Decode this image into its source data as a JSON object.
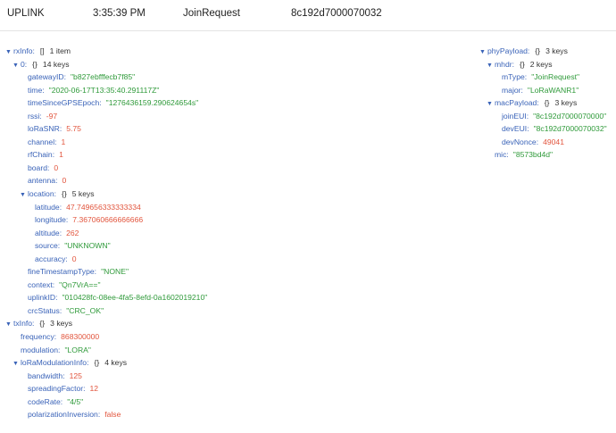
{
  "header": {
    "direction": "UPLINK",
    "time": "3:35:39 PM",
    "type": "JoinRequest",
    "dev_eui": "8c192d7000070032"
  },
  "tree_left": [
    {
      "depth": 0,
      "expandable": true,
      "key": "rxInfo",
      "brace": "[]",
      "meta": "1 item"
    },
    {
      "depth": 1,
      "expandable": true,
      "key": "0",
      "brace": "{}",
      "meta": "14 keys"
    },
    {
      "depth": 2,
      "key": "gatewayID",
      "value": "\"b827ebfffecb7f85\"",
      "vtype": "str"
    },
    {
      "depth": 2,
      "key": "time",
      "value": "\"2020-06-17T13:35:40.291117Z\"",
      "vtype": "str"
    },
    {
      "depth": 2,
      "key": "timeSinceGPSEpoch",
      "value": "\"1276436159.290624654s\"",
      "vtype": "str"
    },
    {
      "depth": 2,
      "key": "rssi",
      "value": "-97",
      "vtype": "num"
    },
    {
      "depth": 2,
      "key": "loRaSNR",
      "value": "5.75",
      "vtype": "num"
    },
    {
      "depth": 2,
      "key": "channel",
      "value": "1",
      "vtype": "num"
    },
    {
      "depth": 2,
      "key": "rfChain",
      "value": "1",
      "vtype": "num"
    },
    {
      "depth": 2,
      "key": "board",
      "value": "0",
      "vtype": "num"
    },
    {
      "depth": 2,
      "key": "antenna",
      "value": "0",
      "vtype": "num"
    },
    {
      "depth": 2,
      "expandable": true,
      "key": "location",
      "brace": "{}",
      "meta": "5 keys"
    },
    {
      "depth": 3,
      "key": "latitude",
      "value": "47.749656333333334",
      "vtype": "num"
    },
    {
      "depth": 3,
      "key": "longitude",
      "value": "7.367060666666666",
      "vtype": "num"
    },
    {
      "depth": 3,
      "key": "altitude",
      "value": "262",
      "vtype": "num"
    },
    {
      "depth": 3,
      "key": "source",
      "value": "\"UNKNOWN\"",
      "vtype": "str"
    },
    {
      "depth": 3,
      "key": "accuracy",
      "value": "0",
      "vtype": "num"
    },
    {
      "depth": 2,
      "key": "fineTimestampType",
      "value": "\"NONE\"",
      "vtype": "str"
    },
    {
      "depth": 2,
      "key": "context",
      "value": "\"Qn7VrA==\"",
      "vtype": "str"
    },
    {
      "depth": 2,
      "key": "uplinkID",
      "value": "\"010428fc-08ee-4fa5-8efd-0a1602019210\"",
      "vtype": "str"
    },
    {
      "depth": 2,
      "key": "crcStatus",
      "value": "\"CRC_OK\"",
      "vtype": "str"
    },
    {
      "depth": 0,
      "expandable": true,
      "key": "txInfo",
      "brace": "{}",
      "meta": "3 keys"
    },
    {
      "depth": 1,
      "key": "frequency",
      "value": "868300000",
      "vtype": "num"
    },
    {
      "depth": 1,
      "key": "modulation",
      "value": "\"LORA\"",
      "vtype": "str"
    },
    {
      "depth": 1,
      "expandable": true,
      "key": "loRaModulationInfo",
      "brace": "{}",
      "meta": "4 keys"
    },
    {
      "depth": 2,
      "key": "bandwidth",
      "value": "125",
      "vtype": "num"
    },
    {
      "depth": 2,
      "key": "spreadingFactor",
      "value": "12",
      "vtype": "num"
    },
    {
      "depth": 2,
      "key": "codeRate",
      "value": "\"4/5\"",
      "vtype": "str"
    },
    {
      "depth": 2,
      "key": "polarizationInversion",
      "value": "false",
      "vtype": "bool"
    }
  ],
  "tree_right": [
    {
      "depth": 0,
      "expandable": true,
      "key": "phyPayload",
      "brace": "{}",
      "meta": "3 keys"
    },
    {
      "depth": 1,
      "expandable": true,
      "key": "mhdr",
      "brace": "{}",
      "meta": "2 keys"
    },
    {
      "depth": 2,
      "key": "mType",
      "value": "\"JoinRequest\"",
      "vtype": "str"
    },
    {
      "depth": 2,
      "key": "major",
      "value": "\"LoRaWANR1\"",
      "vtype": "str"
    },
    {
      "depth": 1,
      "expandable": true,
      "key": "macPayload",
      "brace": "{}",
      "meta": "3 keys"
    },
    {
      "depth": 2,
      "key": "joinEUI",
      "value": "\"8c192d7000070000\"",
      "vtype": "str"
    },
    {
      "depth": 2,
      "key": "devEUI",
      "value": "\"8c192d7000070032\"",
      "vtype": "str"
    },
    {
      "depth": 2,
      "key": "devNonce",
      "value": "49041",
      "vtype": "num"
    },
    {
      "depth": 1,
      "key": "mic",
      "value": "\"8573bd4d\"",
      "vtype": "str"
    }
  ],
  "colors": {
    "key": "#3a63b8",
    "string": "#2f9a3a",
    "number": "#e2553d"
  },
  "icons": {
    "expand": "caret-down-icon"
  }
}
